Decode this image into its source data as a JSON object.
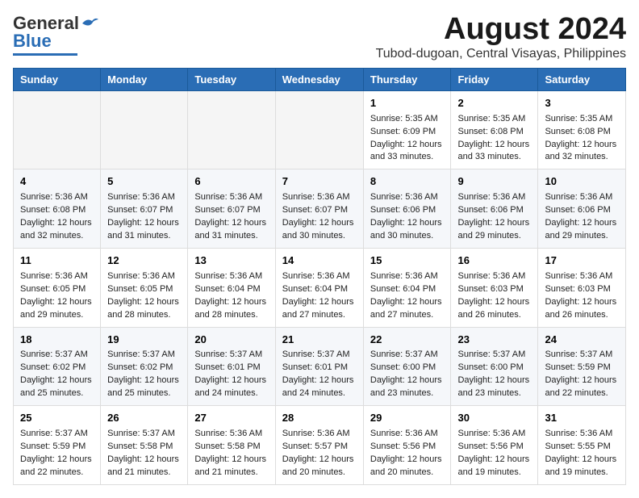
{
  "header": {
    "logo_general": "General",
    "logo_blue": "Blue",
    "main_title": "August 2024",
    "subtitle": "Tubod-dugoan, Central Visayas, Philippines"
  },
  "days_of_week": [
    "Sunday",
    "Monday",
    "Tuesday",
    "Wednesday",
    "Thursday",
    "Friday",
    "Saturday"
  ],
  "weeks": [
    [
      {
        "day": "",
        "info": ""
      },
      {
        "day": "",
        "info": ""
      },
      {
        "day": "",
        "info": ""
      },
      {
        "day": "",
        "info": ""
      },
      {
        "day": "1",
        "info": "Sunrise: 5:35 AM\nSunset: 6:09 PM\nDaylight: 12 hours\nand 33 minutes."
      },
      {
        "day": "2",
        "info": "Sunrise: 5:35 AM\nSunset: 6:08 PM\nDaylight: 12 hours\nand 33 minutes."
      },
      {
        "day": "3",
        "info": "Sunrise: 5:35 AM\nSunset: 6:08 PM\nDaylight: 12 hours\nand 32 minutes."
      }
    ],
    [
      {
        "day": "4",
        "info": "Sunrise: 5:36 AM\nSunset: 6:08 PM\nDaylight: 12 hours\nand 32 minutes."
      },
      {
        "day": "5",
        "info": "Sunrise: 5:36 AM\nSunset: 6:07 PM\nDaylight: 12 hours\nand 31 minutes."
      },
      {
        "day": "6",
        "info": "Sunrise: 5:36 AM\nSunset: 6:07 PM\nDaylight: 12 hours\nand 31 minutes."
      },
      {
        "day": "7",
        "info": "Sunrise: 5:36 AM\nSunset: 6:07 PM\nDaylight: 12 hours\nand 30 minutes."
      },
      {
        "day": "8",
        "info": "Sunrise: 5:36 AM\nSunset: 6:06 PM\nDaylight: 12 hours\nand 30 minutes."
      },
      {
        "day": "9",
        "info": "Sunrise: 5:36 AM\nSunset: 6:06 PM\nDaylight: 12 hours\nand 29 minutes."
      },
      {
        "day": "10",
        "info": "Sunrise: 5:36 AM\nSunset: 6:06 PM\nDaylight: 12 hours\nand 29 minutes."
      }
    ],
    [
      {
        "day": "11",
        "info": "Sunrise: 5:36 AM\nSunset: 6:05 PM\nDaylight: 12 hours\nand 29 minutes."
      },
      {
        "day": "12",
        "info": "Sunrise: 5:36 AM\nSunset: 6:05 PM\nDaylight: 12 hours\nand 28 minutes."
      },
      {
        "day": "13",
        "info": "Sunrise: 5:36 AM\nSunset: 6:04 PM\nDaylight: 12 hours\nand 28 minutes."
      },
      {
        "day": "14",
        "info": "Sunrise: 5:36 AM\nSunset: 6:04 PM\nDaylight: 12 hours\nand 27 minutes."
      },
      {
        "day": "15",
        "info": "Sunrise: 5:36 AM\nSunset: 6:04 PM\nDaylight: 12 hours\nand 27 minutes."
      },
      {
        "day": "16",
        "info": "Sunrise: 5:36 AM\nSunset: 6:03 PM\nDaylight: 12 hours\nand 26 minutes."
      },
      {
        "day": "17",
        "info": "Sunrise: 5:36 AM\nSunset: 6:03 PM\nDaylight: 12 hours\nand 26 minutes."
      }
    ],
    [
      {
        "day": "18",
        "info": "Sunrise: 5:37 AM\nSunset: 6:02 PM\nDaylight: 12 hours\nand 25 minutes."
      },
      {
        "day": "19",
        "info": "Sunrise: 5:37 AM\nSunset: 6:02 PM\nDaylight: 12 hours\nand 25 minutes."
      },
      {
        "day": "20",
        "info": "Sunrise: 5:37 AM\nSunset: 6:01 PM\nDaylight: 12 hours\nand 24 minutes."
      },
      {
        "day": "21",
        "info": "Sunrise: 5:37 AM\nSunset: 6:01 PM\nDaylight: 12 hours\nand 24 minutes."
      },
      {
        "day": "22",
        "info": "Sunrise: 5:37 AM\nSunset: 6:00 PM\nDaylight: 12 hours\nand 23 minutes."
      },
      {
        "day": "23",
        "info": "Sunrise: 5:37 AM\nSunset: 6:00 PM\nDaylight: 12 hours\nand 23 minutes."
      },
      {
        "day": "24",
        "info": "Sunrise: 5:37 AM\nSunset: 5:59 PM\nDaylight: 12 hours\nand 22 minutes."
      }
    ],
    [
      {
        "day": "25",
        "info": "Sunrise: 5:37 AM\nSunset: 5:59 PM\nDaylight: 12 hours\nand 22 minutes."
      },
      {
        "day": "26",
        "info": "Sunrise: 5:37 AM\nSunset: 5:58 PM\nDaylight: 12 hours\nand 21 minutes."
      },
      {
        "day": "27",
        "info": "Sunrise: 5:36 AM\nSunset: 5:58 PM\nDaylight: 12 hours\nand 21 minutes."
      },
      {
        "day": "28",
        "info": "Sunrise: 5:36 AM\nSunset: 5:57 PM\nDaylight: 12 hours\nand 20 minutes."
      },
      {
        "day": "29",
        "info": "Sunrise: 5:36 AM\nSunset: 5:56 PM\nDaylight: 12 hours\nand 20 minutes."
      },
      {
        "day": "30",
        "info": "Sunrise: 5:36 AM\nSunset: 5:56 PM\nDaylight: 12 hours\nand 19 minutes."
      },
      {
        "day": "31",
        "info": "Sunrise: 5:36 AM\nSunset: 5:55 PM\nDaylight: 12 hours\nand 19 minutes."
      }
    ]
  ]
}
